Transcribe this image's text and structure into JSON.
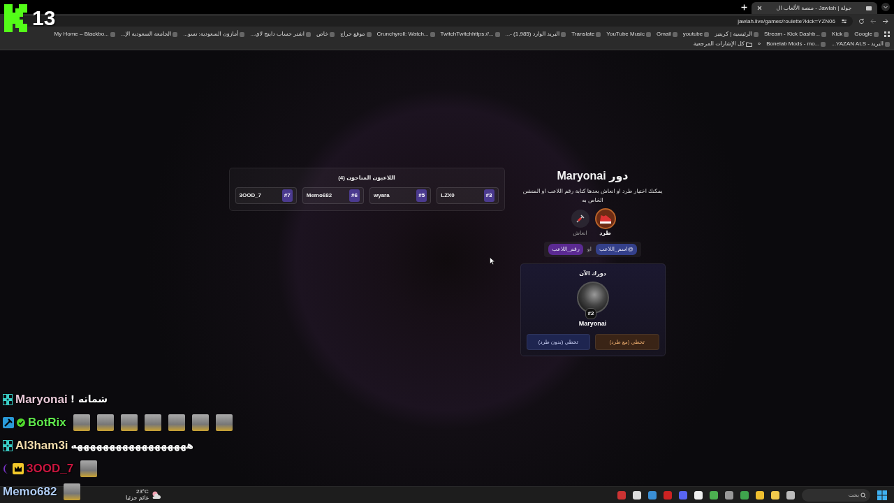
{
  "browser": {
    "tab": {
      "title": "جولة | Jawlah - منصة الألعاب ال",
      "selected": true
    },
    "address": "jawlah.live/games/roulette?kick=YZN06",
    "bookmarks": [
      "Google",
      "Kick",
      "Stream - Kick Dashb...",
      "الرئيسية | كريتيز",
      "youtube",
      "Gmail",
      "YouTube Music",
      "Translate",
      "البريد الوارد (1,985) -...",
      "TwitchTwitchhttps://...",
      "Crunchyroll: Watch...",
      "موقع حراج",
      "خاص",
      "اشتر حساب دايتج لاي...",
      "أمازون السعودية: تسو...",
      "الجامعة السعودية الإ...",
      "My Home – Blackbo...",
      "البريد - YAZAN ALS...",
      "Bonelab Mods - mo..."
    ],
    "overflow": "»",
    "all_bookmarks": "كل الإشارات المرجعية"
  },
  "stream_overlay": {
    "counter": "13"
  },
  "players_panel": {
    "title": "اللاعبون المتاحون (4)",
    "players": [
      {
        "name": "LZX0",
        "number": "#3"
      },
      {
        "name": "wyara",
        "number": "#5"
      },
      {
        "name": "Memo682",
        "number": "#6"
      },
      {
        "name": "3OOD_7",
        "number": "#7"
      }
    ]
  },
  "turn_panel": {
    "title": "دور Maryonai",
    "description": "يمكنك اختيار طرد او انعاش بعدها كتابة رقم اللاعب او المنشن الخاص به",
    "actions": [
      {
        "kind": "kick",
        "label": "طرد",
        "selected": true
      },
      {
        "kind": "revive",
        "label": "انعاش",
        "selected": false
      }
    ],
    "chips": [
      {
        "text": "@اسم_اللاعب",
        "color": "#34408a"
      },
      {
        "text": "رقم_اللاعب",
        "color": "#5b2a92"
      }
    ],
    "or": "او"
  },
  "current_turn": {
    "heading": "دورك الآن",
    "badge": "#2",
    "name": "Maryonai",
    "buttons": [
      {
        "kind": "kick",
        "label": "تخطي (مع طرد)"
      },
      {
        "kind": "skip",
        "label": "تخطي (بدون طرد)"
      }
    ]
  },
  "chat": [
    {
      "user": "Maryonai",
      "color": "#e9c9d8",
      "badges": [
        {
          "kind": "og"
        }
      ],
      "parts": [
        {
          "kind": "text",
          "text": "شماته !"
        }
      ]
    },
    {
      "user": "BotRix",
      "color": "#5fe84c",
      "badges": [
        {
          "kind": "moderator"
        },
        {
          "kind": "verified"
        }
      ],
      "parts": [
        {
          "kind": "emote"
        },
        {
          "kind": "emote"
        },
        {
          "kind": "emote"
        },
        {
          "kind": "emote"
        },
        {
          "kind": "emote"
        },
        {
          "kind": "emote"
        },
        {
          "kind": "emote"
        }
      ]
    },
    {
      "user": "Al3ham3i",
      "color": "#f1dbab",
      "badges": [
        {
          "kind": "og"
        }
      ],
      "parts": [
        {
          "kind": "text",
          "text": "ههههههههههههههههههه"
        }
      ]
    },
    {
      "user": "3OOD_7",
      "color": "#c8163f",
      "badges": [
        {
          "kind": "moon"
        },
        {
          "kind": "crown"
        }
      ],
      "parts": [
        {
          "kind": "emote"
        }
      ]
    },
    {
      "user": "Memo682",
      "color": "#aecbf2",
      "parts": [
        {
          "kind": "emote"
        }
      ]
    }
  ],
  "taskbar": {
    "weather": {
      "temperature": "23°C",
      "condition": "غائم جزئيا"
    },
    "search": {
      "placeholder": "بحث"
    }
  }
}
